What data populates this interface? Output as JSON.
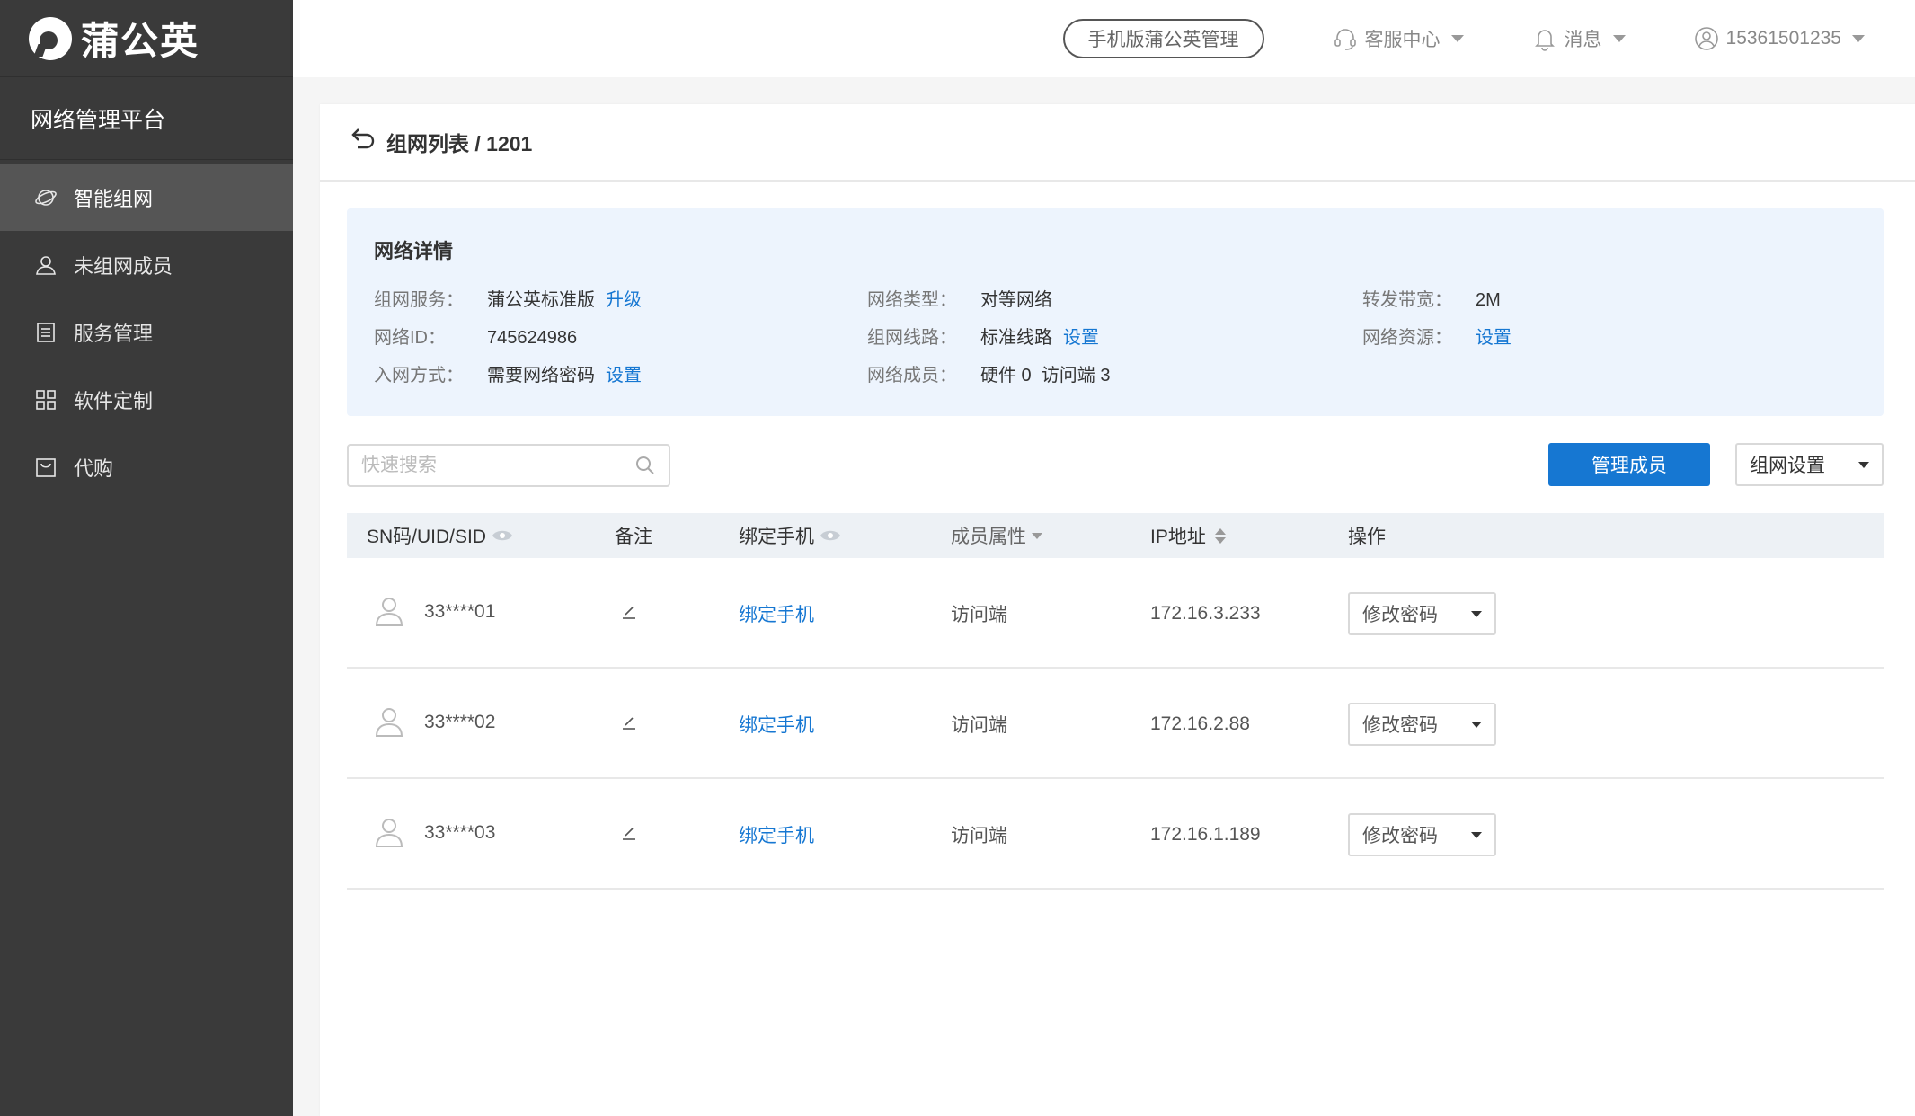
{
  "brand": {
    "name": "蒲公英",
    "platform": "网络管理平台"
  },
  "sidebar": {
    "items": [
      {
        "label": "智能组网",
        "icon": "planet-icon",
        "active": true
      },
      {
        "label": "未组网成员",
        "icon": "user-icon",
        "active": false
      },
      {
        "label": "服务管理",
        "icon": "list-icon",
        "active": false
      },
      {
        "label": "软件定制",
        "icon": "grid-icon",
        "active": false
      },
      {
        "label": "代购",
        "icon": "bag-icon",
        "active": false
      }
    ]
  },
  "topbar": {
    "mobile_btn": "手机版蒲公英管理",
    "support": "客服中心",
    "messages": "消息",
    "account": "15361501235"
  },
  "breadcrumb": "组网列表 / 1201",
  "details": {
    "title": "网络详情",
    "service_label": "组网服务：",
    "service_value": "蒲公英标准版",
    "service_link": "升级",
    "type_label": "网络类型：",
    "type_value": "对等网络",
    "bandwidth_label": "转发带宽：",
    "bandwidth_value": "2M",
    "id_label": "网络ID：",
    "id_value": "745624986",
    "line_label": "组网线路：",
    "line_value": "标准线路",
    "line_link": "设置",
    "resource_label": "网络资源：",
    "resource_link": "设置",
    "join_label": "入网方式：",
    "join_value": "需要网络密码",
    "join_link": "设置",
    "members_label": "网络成员：",
    "members_value": "硬件 0  访问端 3"
  },
  "toolbar": {
    "search_placeholder": "快速搜索",
    "manage_btn": "管理成员",
    "settings_btn": "组网设置"
  },
  "table": {
    "headers": {
      "sn": "SN码/UID/SID",
      "note": "备注",
      "phone": "绑定手机",
      "attr": "成员属性",
      "ip": "IP地址",
      "op": "操作"
    },
    "rows": [
      {
        "sn": "33****01",
        "phone": "绑定手机",
        "attr": "访问端",
        "ip": "172.16.3.233",
        "op": "修改密码"
      },
      {
        "sn": "33****02",
        "phone": "绑定手机",
        "attr": "访问端",
        "ip": "172.16.2.88",
        "op": "修改密码"
      },
      {
        "sn": "33****03",
        "phone": "绑定手机",
        "attr": "访问端",
        "ip": "172.16.1.189",
        "op": "修改密码"
      }
    ]
  },
  "colors": {
    "accent": "#1677d2",
    "sidebar_bg": "#3a3a3a",
    "detail_bg": "#edf4fd"
  }
}
